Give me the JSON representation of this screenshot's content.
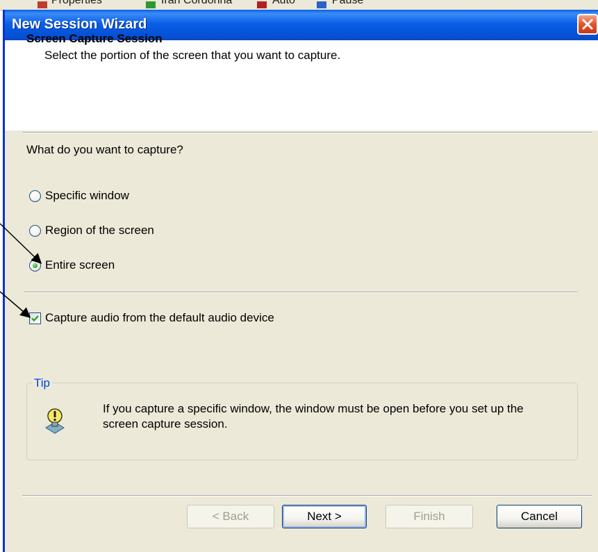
{
  "background_toolbar": {
    "fragments": [
      "Properties",
      "Iran Cordonna",
      "Auto",
      "Pause"
    ]
  },
  "window": {
    "title": "New Session Wizard"
  },
  "header": {
    "title": "Screen Capture Session",
    "subtitle": "Select the portion of the screen that you want to capture."
  },
  "capture": {
    "question": "What do you want to capture?",
    "options": [
      {
        "label": "Specific window",
        "checked": false
      },
      {
        "label": "Region of the screen",
        "checked": false
      },
      {
        "label": "Entire screen",
        "checked": true
      }
    ]
  },
  "audio": {
    "label": "Capture audio from the default audio device",
    "checked": true
  },
  "tip": {
    "title": "Tip",
    "icon": "lightbulb-tip-icon",
    "text": "If you capture a specific window, the window must be open before you set up the screen capture session."
  },
  "buttons": {
    "back": "< Back",
    "next": "Next >",
    "finish": "Finish",
    "cancel": "Cancel"
  },
  "colors": {
    "titlebar": "#0453d8",
    "dialog_bg": "#ece9d8",
    "tip_title": "#0046d5",
    "close_button": "#e2542b"
  }
}
